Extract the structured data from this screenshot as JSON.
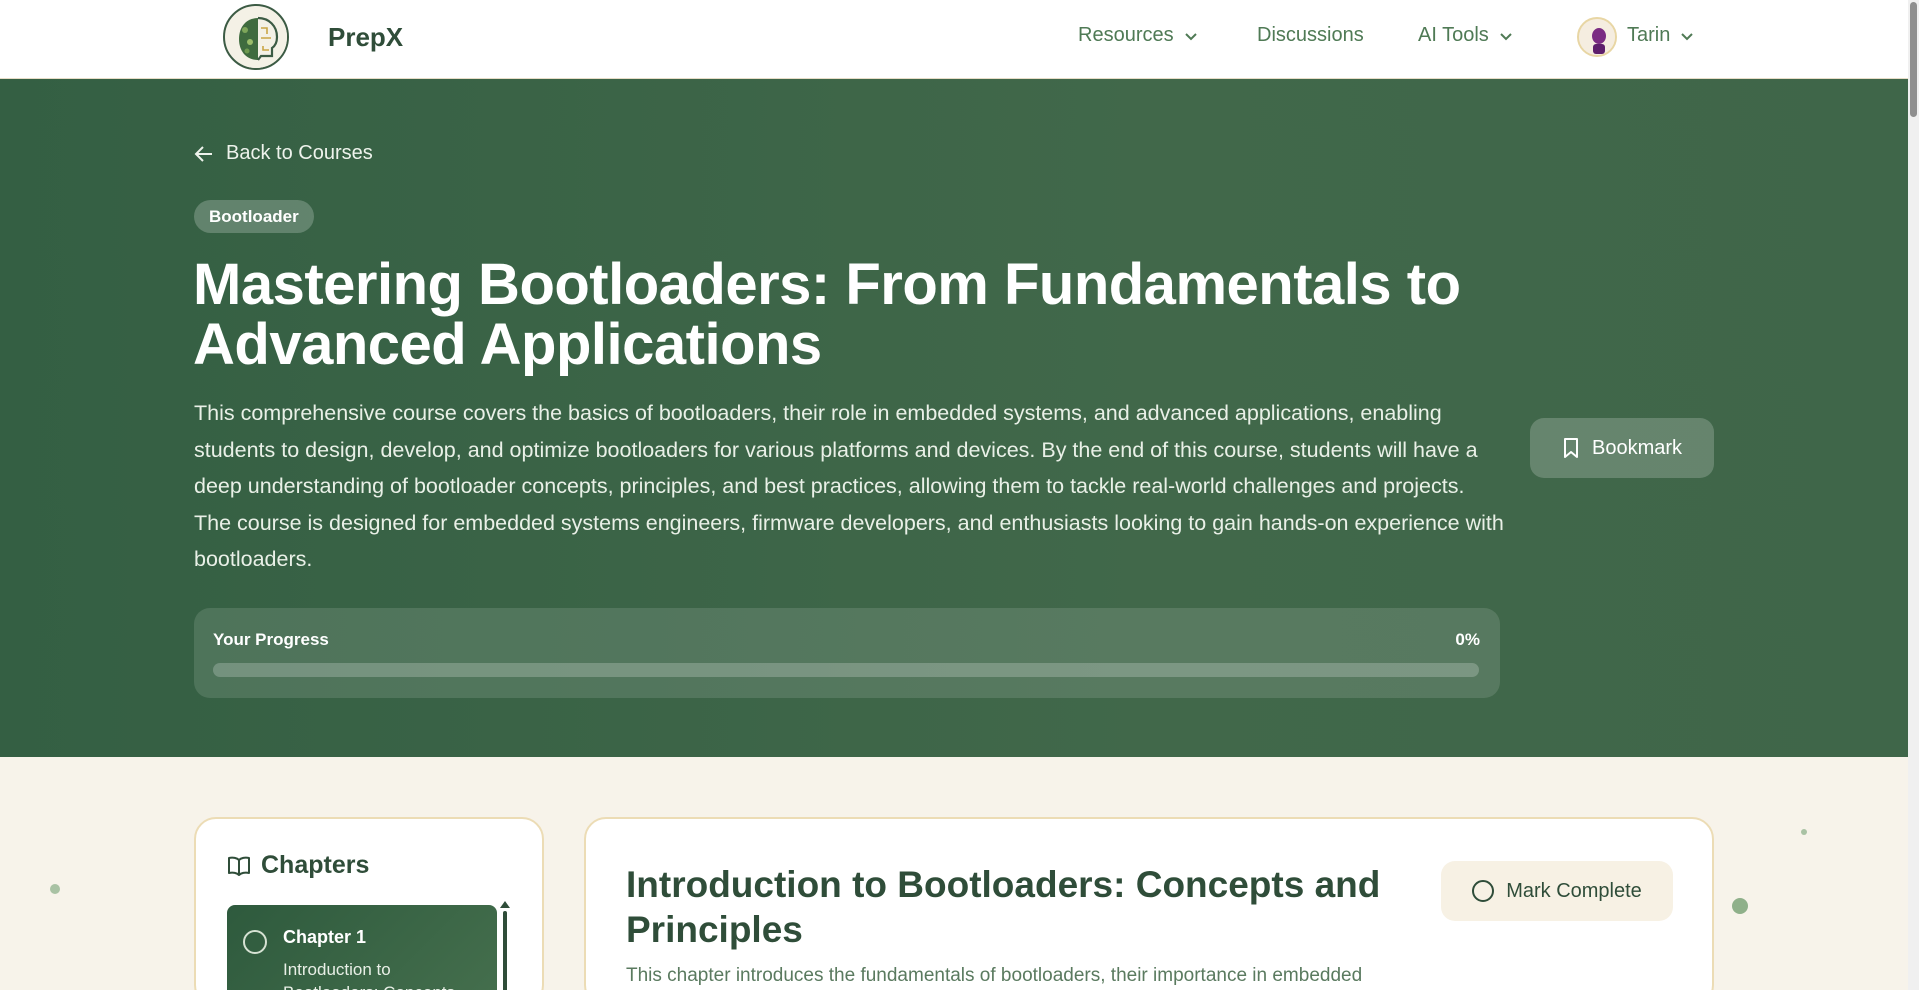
{
  "header": {
    "brand": "PrepX",
    "nav": {
      "resources": "Resources",
      "discussions": "Discussions",
      "ai_tools": "AI Tools",
      "user": "Tarin"
    }
  },
  "hero": {
    "back_label": "Back to Courses",
    "tag": "Bootloader",
    "title": "Mastering Bootloaders: From Fundamentals to Advanced Applications",
    "description": "This comprehensive course covers the basics of bootloaders, their role in embedded systems, and advanced applications, enabling students to design, develop, and optimize bootloaders for various platforms and devices. By the end of this course, students will have a deep understanding of bootloader concepts, principles, and best practices, allowing them to tackle real-world challenges and projects. The course is designed for embedded systems engineers, firmware developers, and enthusiasts looking to gain hands-on experience with bootloaders.",
    "bookmark_label": "Bookmark",
    "progress": {
      "label": "Your Progress",
      "percent_text": "0%",
      "value": 0
    }
  },
  "chapters": {
    "heading": "Chapters",
    "items": [
      {
        "number": "Chapter 1",
        "title": "Introduction to Bootloaders: Concepts"
      }
    ]
  },
  "content": {
    "title": "Introduction to Bootloaders: Concepts and Principles",
    "mark_complete_label": "Mark Complete",
    "description": "This chapter introduces the fundamentals of bootloaders, their importance in embedded"
  },
  "colors": {
    "primary": "#2f4d39",
    "hero_bg": "#3f6649",
    "accent": "#4f7a55",
    "page_bg": "#f7f3ea",
    "border": "#ecdcb5"
  },
  "icons": [
    "brain-logo-icon",
    "chevron-down-icon",
    "arrow-left-icon",
    "bookmark-icon",
    "book-open-icon",
    "circle-icon"
  ]
}
